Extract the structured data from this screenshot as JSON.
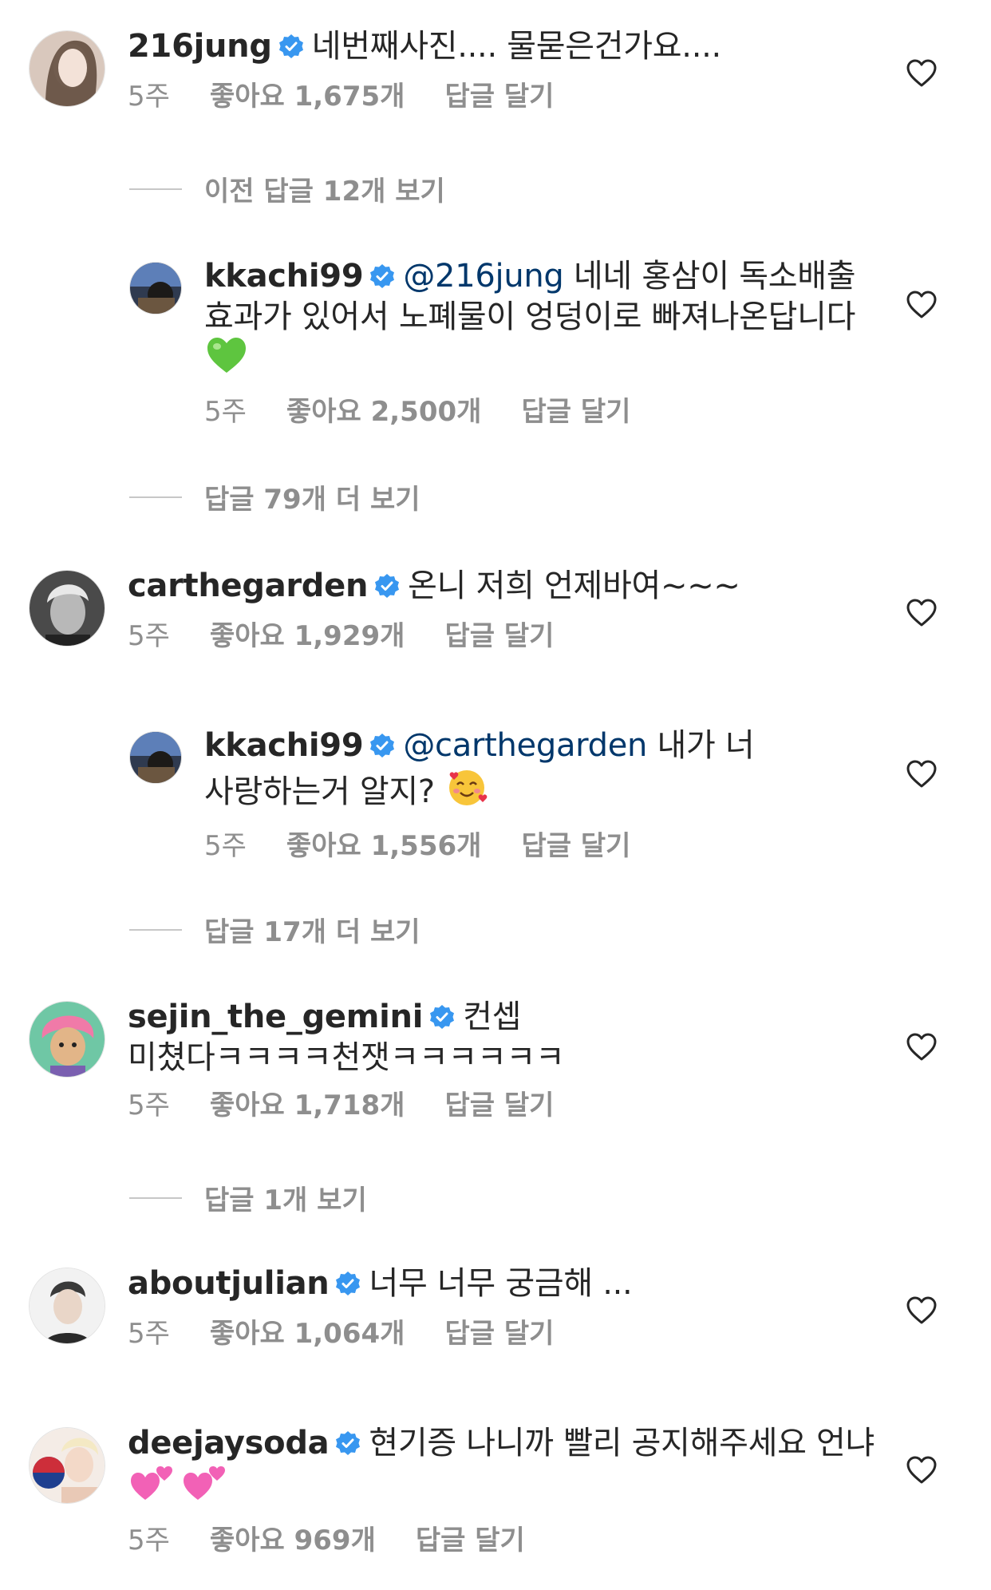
{
  "colors": {
    "text": "#262626",
    "muted": "#8e8e8e",
    "mention": "#00376b",
    "verified": "#3897f0"
  },
  "comments": [
    {
      "user": "216jung",
      "text": "네번째사진.... 물묻은건가요....",
      "time": "5주",
      "likes": "좋아요 1,675개",
      "reply": "답글 달기"
    },
    {
      "user": "kkachi99",
      "mention": "@216jung",
      "text": " 네네 홍삼이 독소배출 효과가 있어서 노폐물이 엉덩이로 빠져나온답니다",
      "emoji": "green-heart",
      "time": "5주",
      "likes": "좋아요 2,500개",
      "reply": "답글 달기"
    },
    {
      "user": "carthegarden",
      "text": "온니 저희 언제바여~~~",
      "time": "5주",
      "likes": "좋아요 1,929개",
      "reply": "답글 달기"
    },
    {
      "user": "kkachi99",
      "mention": "@carthegarden",
      "text": " 내가 너 사랑하는거 알지? ",
      "emoji": "smiling-face-with-hearts",
      "time": "5주",
      "likes": "좋아요 1,556개",
      "reply": "답글 달기"
    },
    {
      "user": "sejin_the_gemini",
      "text": "컨셉 미쳤다ㅋㅋㅋㅋ천잿ㅋㅋㅋㅋㅋㅋ",
      "time": "5주",
      "likes": "좋아요 1,718개",
      "reply": "답글 달기"
    },
    {
      "user": "aboutjulian",
      "text": "너무 너무 궁금해 ...",
      "time": "5주",
      "likes": "좋아요 1,064개",
      "reply": "답글 달기"
    },
    {
      "user": "deejaysoda",
      "text": "현기증 나니까 빨리 공지해주세요 언냐",
      "emoji": "two-hearts",
      "time": "5주",
      "likes": "좋아요 969개",
      "reply": "답글 달기"
    }
  ],
  "view_more": [
    "이전 답글 12개 보기",
    "답글 79개 더 보기",
    "답글 17개 더 보기",
    "답글 1개 보기"
  ]
}
